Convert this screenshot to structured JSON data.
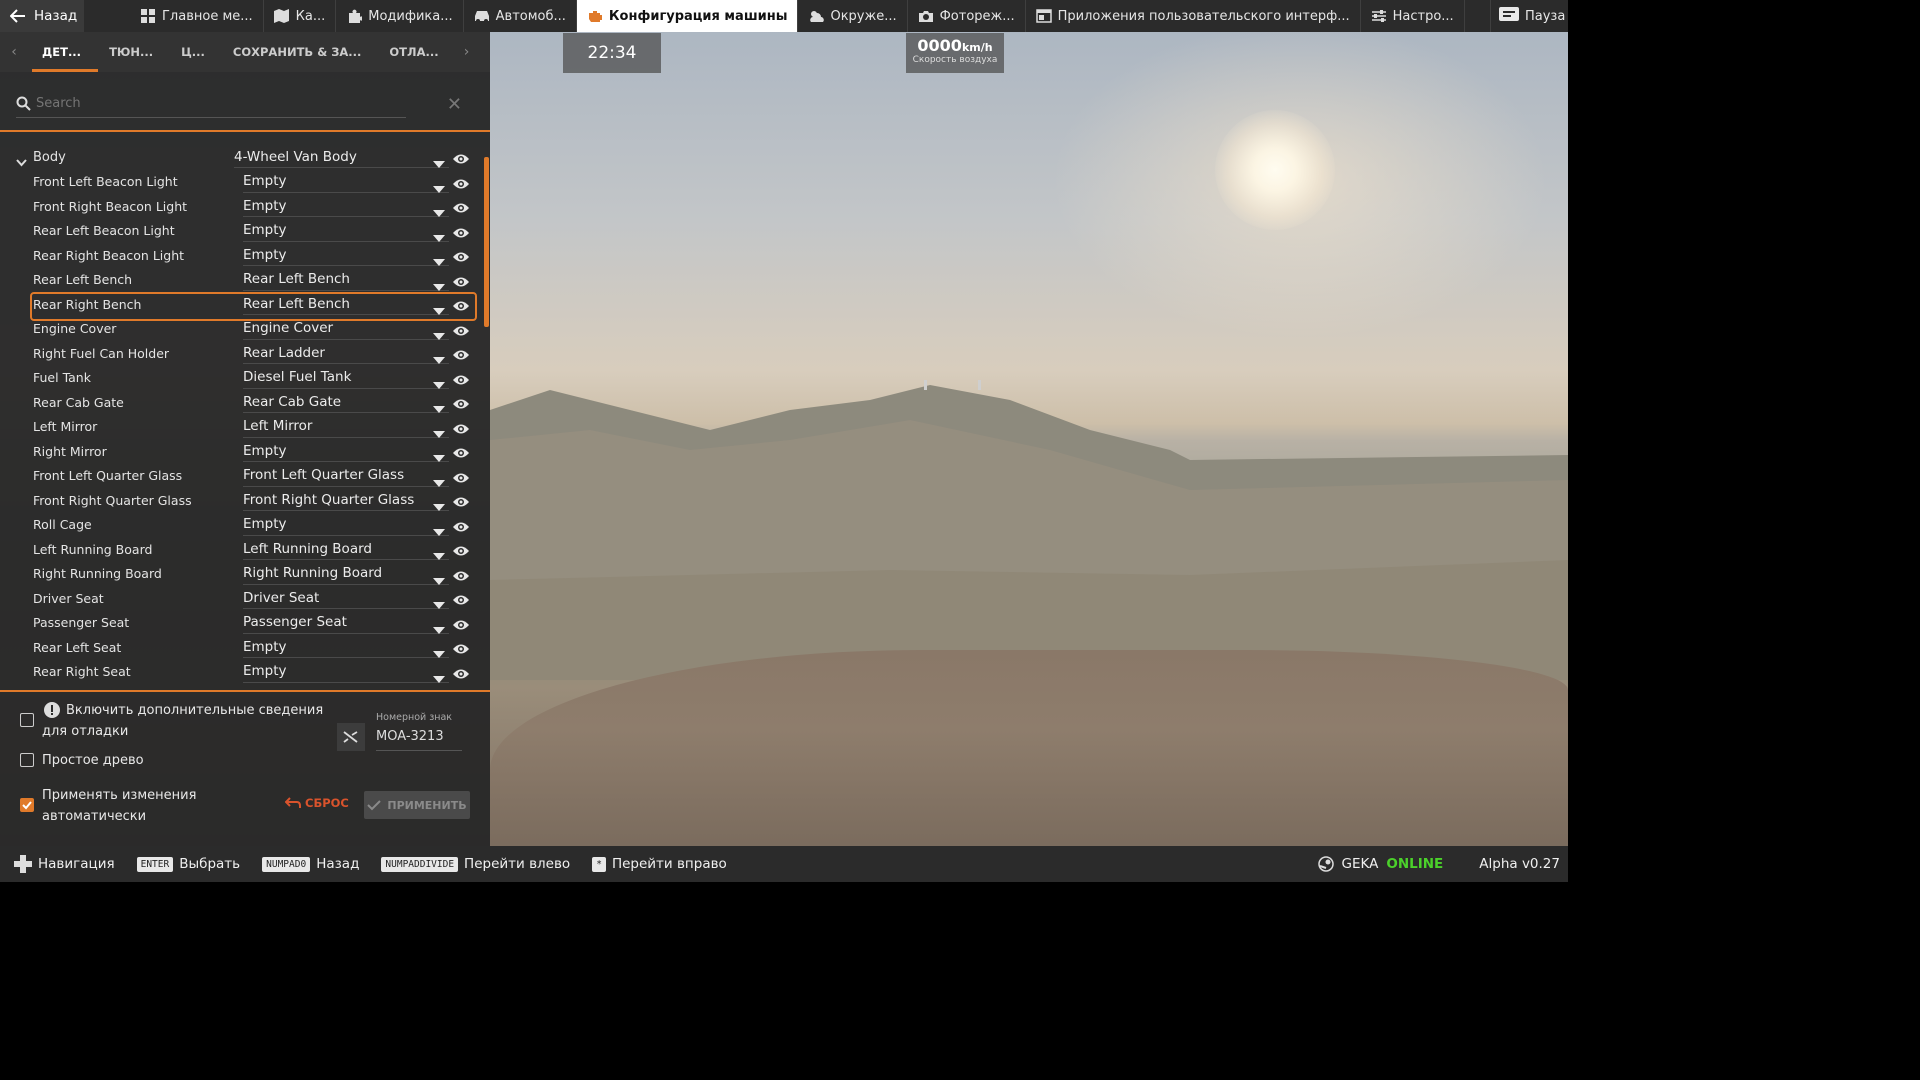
{
  "topbar": {
    "back_label": "Назад",
    "tabs": [
      {
        "label": "Главное ме...",
        "icon": "grid-icon"
      },
      {
        "label": "Ка...",
        "icon": "map-icon"
      },
      {
        "label": "Модифика...",
        "icon": "puzzle-icon"
      },
      {
        "label": "Автомоб...",
        "icon": "car-icon"
      },
      {
        "label": "Конфигурация машины",
        "icon": "engine-icon",
        "active": true
      },
      {
        "label": "Окруже...",
        "icon": "weather-icon"
      },
      {
        "label": "Фотореж...",
        "icon": "camera-icon"
      },
      {
        "label": "Приложения пользовательского интерф...",
        "icon": "window-icon"
      },
      {
        "label": "Настро...",
        "icon": "sliders-icon"
      }
    ],
    "pause_label": "Пауза"
  },
  "subtabs": [
    "ДЕТ...",
    "ТЮН...",
    "Ц...",
    "СОХРАНИТЬ & ЗА...",
    "ОТЛА..."
  ],
  "search": {
    "placeholder": "Search"
  },
  "tree": {
    "head": {
      "label": "Body",
      "value": "4-Wheel Van Body"
    },
    "rows": [
      {
        "label": "Front Left Beacon Light",
        "value": "Empty"
      },
      {
        "label": "Front Right Beacon Light",
        "value": "Empty"
      },
      {
        "label": "Rear Left Beacon Light",
        "value": "Empty"
      },
      {
        "label": "Rear Right Beacon Light",
        "value": "Empty"
      },
      {
        "label": "Rear Left Bench",
        "value": "Rear Left Bench"
      },
      {
        "label": "Rear Right Bench",
        "value": "Rear Left Bench",
        "selected": true
      },
      {
        "label": "Engine Cover",
        "value": "Engine Cover"
      },
      {
        "label": "Right Fuel Can Holder",
        "value": "Rear Ladder"
      },
      {
        "label": "Fuel Tank",
        "value": "Diesel Fuel Tank"
      },
      {
        "label": "Rear Cab Gate",
        "value": "Rear Cab Gate"
      },
      {
        "label": "Left Mirror",
        "value": "Left Mirror"
      },
      {
        "label": "Right Mirror",
        "value": "Empty"
      },
      {
        "label": "Front Left Quarter Glass",
        "value": "Front Left Quarter Glass"
      },
      {
        "label": "Front Right Quarter Glass",
        "value": "Front Right Quarter Glass"
      },
      {
        "label": "Roll Cage",
        "value": "Empty"
      },
      {
        "label": "Left Running Board",
        "value": "Left Running Board"
      },
      {
        "label": "Right Running Board",
        "value": "Right Running Board"
      },
      {
        "label": "Driver Seat",
        "value": "Driver Seat"
      },
      {
        "label": "Passenger Seat",
        "value": "Passenger Seat"
      },
      {
        "label": "Rear Left Seat",
        "value": "Empty"
      },
      {
        "label": "Rear Right Seat",
        "value": "Empty"
      }
    ]
  },
  "options": {
    "debug_line1": "Включить дополнительные сведения",
    "debug_line2": "для отладки",
    "simple_tree": "Простое древо",
    "auto_apply_line1": "Применять изменения",
    "auto_apply_line2": "автоматически",
    "debug_checked": false,
    "simple_checked": false,
    "auto_checked": true,
    "plate_label": "Номерной знак",
    "plate_value": "MOA-3213",
    "reset_label": "СБРОС",
    "apply_label": "ПРИМЕНИТЬ"
  },
  "hud": {
    "clock": "22:34",
    "speed_value": "0000",
    "speed_unit": "km/h",
    "speed_caption": "Скорость воздуха"
  },
  "bottombar": {
    "nav_label": "Навигация",
    "hints": [
      {
        "key": "ENTER",
        "label": "Выбрать"
      },
      {
        "key": "NUMPAD0",
        "label": "Назад"
      },
      {
        "key": "NUMPADDIVIDE",
        "label": "Перейти влево"
      },
      {
        "key": "*",
        "label": "Перейти вправо"
      }
    ],
    "user": "GEKA",
    "status": "ONLINE",
    "version": "Alpha v0.27"
  },
  "colors": {
    "accent": "#e07a2a",
    "online": "#4bd12b",
    "reset": "#d9532c"
  }
}
